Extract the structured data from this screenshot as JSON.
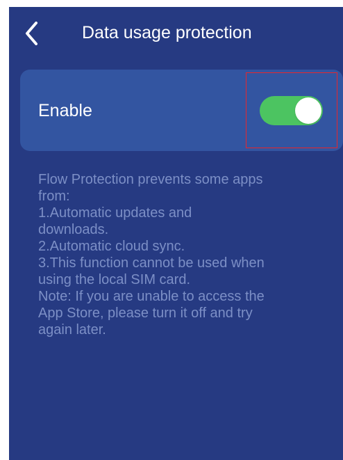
{
  "header": {
    "title": "Data usage protection",
    "back_icon": "chevron-left-icon"
  },
  "setting": {
    "label": "Enable",
    "enabled": true,
    "toggle_on_color": "#4cc461"
  },
  "description": {
    "lines": [
      "Flow Protection prevents some apps",
      "from:",
      "1.Automatic updates and",
      "downloads.",
      "2.Automatic cloud sync.",
      "3.This function cannot be used when",
      "using the local SIM card.",
      "Note: If you are unable to access the",
      "App Store, please turn it off and try",
      "again later."
    ]
  },
  "colors": {
    "background": "#263a82",
    "card": "#3355a1",
    "text_primary": "#ffffff",
    "text_secondary": "#7c8fc6",
    "highlight_border": "#e8262b"
  }
}
